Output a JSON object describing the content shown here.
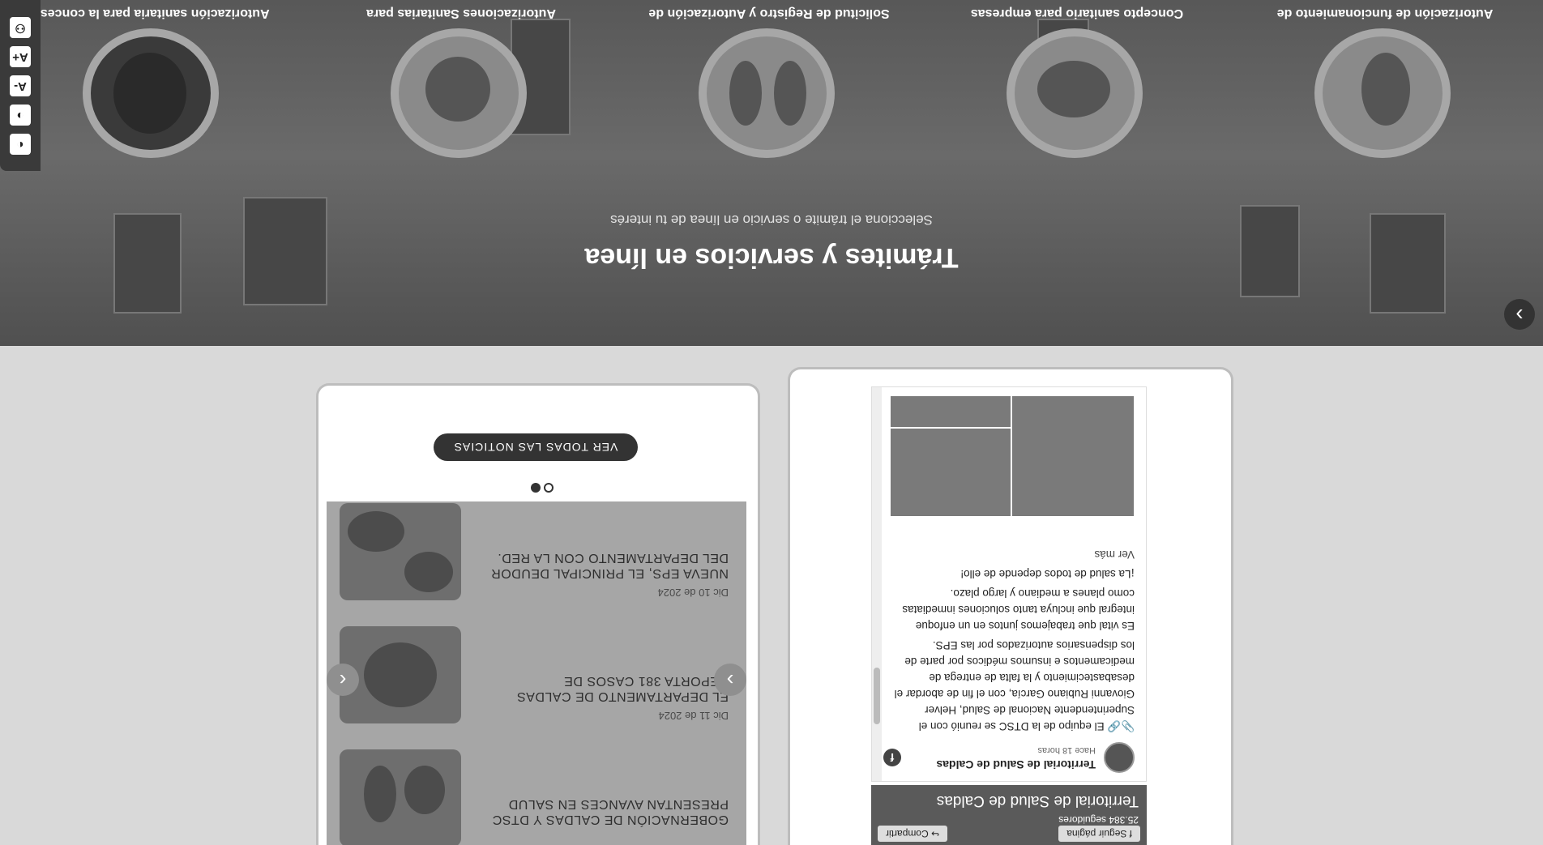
{
  "hero": {
    "title": "Trámites y servicios en línea",
    "subtitle": "Selecciona el trámite o servicio en línea de tu interés",
    "tramites": [
      {
        "label": "Autorización de funcionamiento de"
      },
      {
        "label": "Concepto sanitario para empresas"
      },
      {
        "label": "Solicitud de Registro y Autorización de"
      },
      {
        "label": "Autorizaciones Sanitarias para"
      },
      {
        "label": "Autorización sanitaria para la concesi"
      }
    ],
    "next_label": "›"
  },
  "accessibility": {
    "buttons": [
      {
        "label": "◐",
        "icon": "contrast-icon"
      },
      {
        "label": "◑",
        "icon": "night-mode-icon"
      },
      {
        "label": "A-",
        "icon": "font-decrease-icon"
      },
      {
        "label": "A+",
        "icon": "font-increase-icon"
      },
      {
        "label": "⚇",
        "icon": "accessibility-icon"
      }
    ]
  },
  "news": {
    "items": [
      {
        "date": "Dic 10 de 2024",
        "title": "NUEVA EPS, EL PRINCIPAL DEUDOR DEL DEPARTAMENTO CON LA RED."
      },
      {
        "date": "Dic 11 de 2024",
        "title": "EL DEPARTAMENTO DE CALDAS REPORTA 381 CASOS DE"
      },
      {
        "date": "",
        "title": "GOBERNACIÓN DE CALDAS Y DTSC PRESENTAN AVANCES EN SALUD"
      }
    ],
    "prev_label": "‹",
    "next_label": "›",
    "view_all_label": "VER TODAS LAS NOTICIAS"
  },
  "facebook": {
    "page_name": "Territorial de Salud de Caldas",
    "followers": "25.384 seguidores",
    "follow_label": "Seguir página",
    "share_label": "Compartir",
    "post": {
      "author": "Territorial de Salud de Caldas",
      "time": "Hace 18 horas",
      "paragraphs": [
        "📎🔗 El equipo de la DTSC se reunió con el Superintendente Nacional de Salud, Helver Giovanni Rubiano García, con el fin de abordar el desabastecimiento y la falta de entrega de medicamentos e insumos médicos por parte de los dispensarios autorizados por las EPS.",
        "Es vital que trabajemos juntos en un enfoque integral que incluya tanto soluciones inmediatas como planes a mediano y largo plazo.",
        "¡La salud de todos depende de ello!"
      ],
      "more_label": "Ver más"
    }
  }
}
